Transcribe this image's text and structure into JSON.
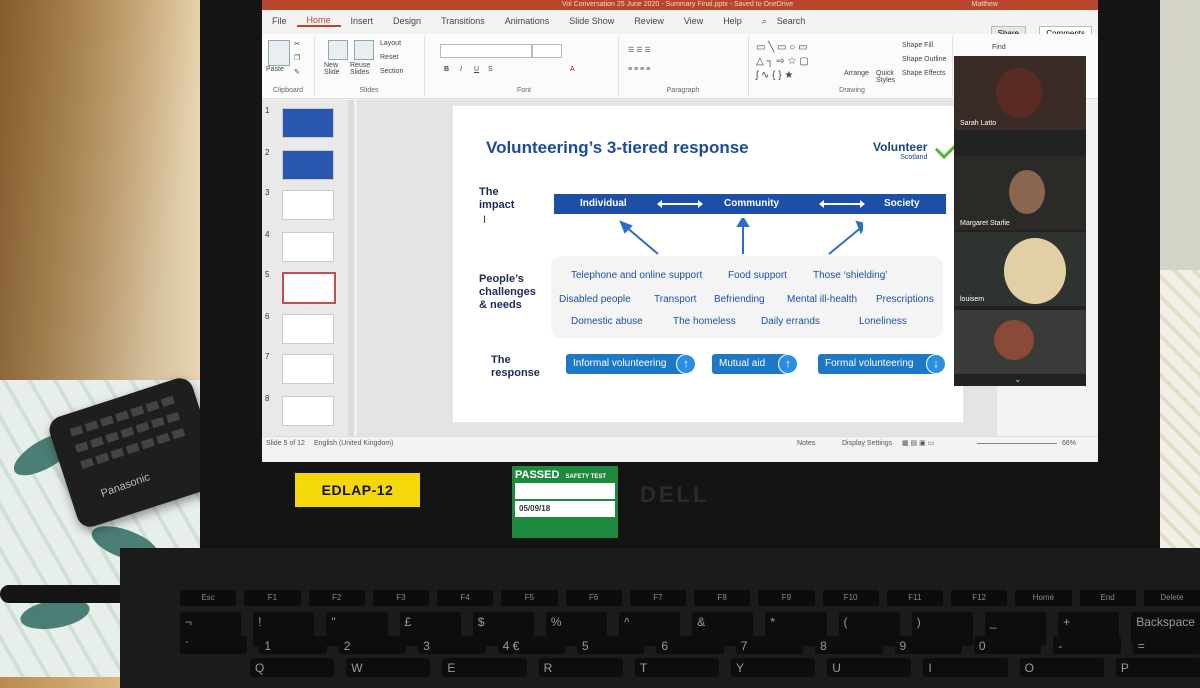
{
  "window": {
    "title": "Vol Conversation 25 June 2020 - Summary Final.pptx - Saved to OneDrive",
    "user": "Matthew",
    "tabs": [
      "File",
      "Home",
      "Insert",
      "Design",
      "Transitions",
      "Animations",
      "Slide Show",
      "Review",
      "View",
      "Help"
    ],
    "active_tab": "Home",
    "search": "Search",
    "share": "Share",
    "comments": "Comments"
  },
  "ribbon": {
    "paste": "Paste",
    "clipboard": "Clipboard",
    "new_slide": "New Slide",
    "reuse_slides": "Reuse Slides",
    "layout": "Layout",
    "reset": "Reset",
    "section": "Section",
    "slides": "Slides",
    "font": "Font",
    "paragraph": "Paragraph",
    "drawing": "Drawing",
    "arrange": "Arrange",
    "quick_styles": "Quick Styles",
    "shape_fill": "Shape Fill",
    "shape_outline": "Shape Outline",
    "shape_effects": "Shape Effects",
    "find": "Find",
    "bold": "B",
    "italic": "I",
    "underline": "U",
    "strike": "S"
  },
  "thumbnails": [
    "1",
    "2",
    "3",
    "4",
    "5",
    "6",
    "7",
    "8"
  ],
  "selected_slide": 5,
  "slide": {
    "title": "Volunteering’s 3-tiered response",
    "logo": "Volunteer",
    "logo_sub": "Scotland",
    "impact_label": [
      "The",
      "impact"
    ],
    "tiers": [
      "Individual",
      "Community",
      "Society"
    ],
    "needs_label": [
      "People’s",
      "challenges",
      "& needs"
    ],
    "needs": [
      "Telephone and online support",
      "Food support",
      "Those ‘shielding’",
      "Disabled people",
      "Transport",
      "Befriending",
      "Mental ill-health",
      "Prescriptions",
      "Domestic abuse",
      "The homeless",
      "Daily errands",
      "Loneliness"
    ],
    "response_label": [
      "The",
      "response"
    ],
    "responses": [
      {
        "label": "Informal volunteering",
        "dir": "↑"
      },
      {
        "label": "Mutual aid",
        "dir": "↑"
      },
      {
        "label": "Formal volunteering",
        "dir": "↓"
      }
    ]
  },
  "status": {
    "slide_of": "Slide 5 of 12",
    "language": "English (United Kingdom)",
    "notes": "Notes",
    "display_settings": "Display Settings",
    "zoom": "66%"
  },
  "zoom_participants": [
    "Sarah Latto",
    "Margaret Starlie",
    "louisem"
  ],
  "labels": {
    "asset_tag": "EDLAP-12",
    "safety": "PASSED",
    "safety_sub": "SAFETY TEST",
    "safety_date": "05/09/18",
    "brand": "DELL"
  },
  "remote_brand": "Panasonic",
  "keyboard": {
    "fn": [
      "Esc",
      "F1",
      "F2",
      "F3",
      "F4",
      "F5",
      "F6",
      "F7",
      "F8",
      "F9",
      "F10",
      "F11",
      "F12",
      "Home",
      "End",
      "Delete"
    ],
    "num": [
      "¬",
      "!",
      "\"",
      "£",
      "$",
      "%",
      "^",
      "&",
      "*",
      "(",
      ")",
      "_",
      "+",
      "Backspace"
    ],
    "num2": [
      "`",
      "1",
      "2",
      "3",
      "4 €",
      "5",
      "6",
      "7",
      "8",
      "9",
      "0",
      "-",
      "="
    ],
    "alpha": [
      "Q",
      "W",
      "E",
      "R",
      "T",
      "Y",
      "U",
      "I",
      "O",
      "P"
    ]
  }
}
